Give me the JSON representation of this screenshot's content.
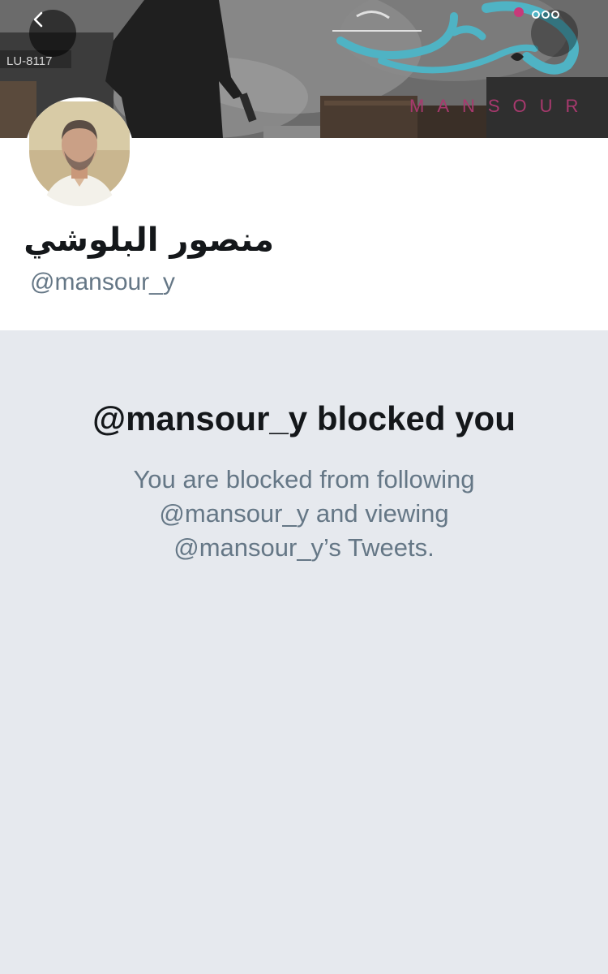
{
  "header": {
    "back_icon": "chevron-left-icon",
    "more_icon": "more-dots-icon",
    "banner_text": "MANSOUR",
    "plate_text": "LU-8117"
  },
  "profile": {
    "display_name": "منصور البلوشي",
    "handle": "@mansour_y"
  },
  "blocked": {
    "title": "@mansour_y blocked you",
    "lines": [
      "You are blocked from following",
      "@mansour_y and viewing",
      "@mansour_y’s Tweets."
    ]
  },
  "colors": {
    "page_background": "#e6e9ee",
    "title_text": "#14171a",
    "secondary_text": "#657786",
    "banner_accent": "#4fb3c4",
    "banner_magenta": "#a8396e"
  }
}
